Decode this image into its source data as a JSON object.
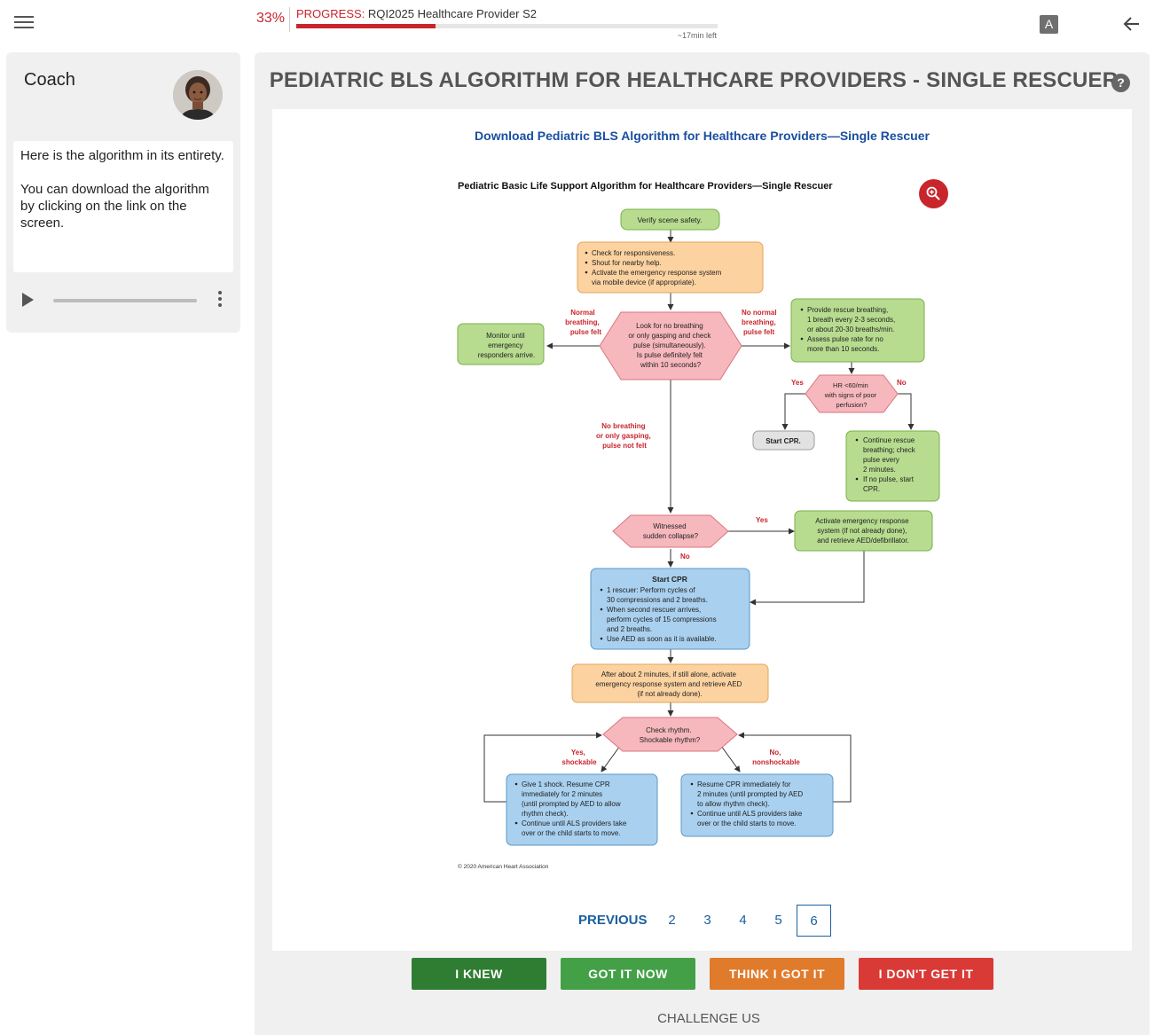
{
  "header": {
    "progress_percent_label": "33%",
    "progress_prefix": "PROGRESS:",
    "progress_course": "RQI2025 Healthcare Provider S2",
    "progress_value": 0.33,
    "time_left": "~17min left",
    "font_button_label": "A"
  },
  "coach": {
    "title": "Coach",
    "message_1": "Here is the algorithm in its entirety.",
    "message_2": "You can download the algorithm by clicking on the link on the screen."
  },
  "main": {
    "title": "PEDIATRIC BLS ALGORITHM FOR HEALTHCARE PROVIDERS - SINGLE RESCUER",
    "help_label": "?",
    "download_link": "Download Pediatric BLS Algorithm for Healthcare Providers—Single Rescuer"
  },
  "algorithm": {
    "title": "Pediatric Basic Life Support Algorithm for Healthcare Providers—Single Rescuer",
    "verify": "Verify scene safety.",
    "check": [
      "Check for responsiveness.",
      "Shout for nearby help.",
      "Activate the emergency response system",
      "via mobile device (if appropriate)."
    ],
    "look": [
      "Look for no breathing",
      "or only gasping and check",
      "pulse (simultaneously).",
      "Is pulse definitely felt",
      "within 10 seconds?"
    ],
    "normal_label": [
      "Normal",
      "breathing,",
      "pulse felt"
    ],
    "monitor": [
      "Monitor until",
      "emergency",
      "responders arrive."
    ],
    "no_normal_label": [
      "No normal",
      "breathing,",
      "pulse felt"
    ],
    "rescue": [
      "Provide rescue breathing,",
      "1 breath every 2-3 seconds,",
      "or about 20-30 breaths/min.",
      "Assess pulse rate for no",
      "more than 10 seconds."
    ],
    "hr_yes": "Yes",
    "hr_no": "No",
    "hr": [
      "HR <60/min",
      "with signs of poor",
      "perfusion?"
    ],
    "start_cpr_small": "Start CPR.",
    "continue": [
      "Continue rescue",
      "breathing; check",
      "pulse every",
      "2 minutes.",
      "If no pulse, start",
      "CPR."
    ],
    "no_breathing_label": [
      "No breathing",
      "or only gasping,",
      "pulse not felt"
    ],
    "witnessed": [
      "Witnessed",
      "sudden collapse?"
    ],
    "witnessed_yes": "Yes",
    "witnessed_no": "No",
    "activate": [
      "Activate emergency response",
      "system (if not already done),",
      "and retrieve AED/defibrillator."
    ],
    "cpr_title": "Start CPR",
    "cpr": [
      "1 rescuer: Perform cycles of",
      "30 compressions and 2 breaths.",
      "When second rescuer arrives,",
      "perform cycles of 15 compressions",
      "and 2 breaths.",
      "Use AED as soon as it is available."
    ],
    "after": [
      "After about 2 minutes, if still alone, activate",
      "emergency response system and retrieve AED",
      "(if not already done)."
    ],
    "rhythm": [
      "Check rhythm.",
      "Shockable rhythm?"
    ],
    "shockable_label": [
      "Yes,",
      "shockable"
    ],
    "nonshockable_label": [
      "No,",
      "nonshockable"
    ],
    "shock": [
      "Give 1 shock. Resume CPR",
      "immediately for 2 minutes",
      "(until prompted by AED to allow",
      "rhythm check).",
      "Continue until ALS providers take",
      "over or the child starts to move."
    ],
    "resume": [
      "Resume CPR immediately for",
      "2 minutes (until prompted by AED",
      "to allow rhythm check).",
      "Continue until ALS providers take",
      "over or the child starts to move."
    ],
    "copyright": "© 2020 American Heart Association"
  },
  "pagination": {
    "previous": "PREVIOUS",
    "pages": [
      "2",
      "3",
      "4",
      "5",
      "6"
    ],
    "current": "6"
  },
  "answers": {
    "knew": "I KNEW",
    "got_it_now": "GOT IT NOW",
    "think": "THINK I GOT IT",
    "dont": "I DON'T GET IT"
  },
  "challenge": "CHALLENGE US",
  "colors": {
    "brand_red": "#c8252c",
    "link_blue": "#1a4fa0",
    "knew": "#2e7d32",
    "got_it_now": "#43a047",
    "think": "#e07b2c",
    "dont": "#d93a36"
  },
  "icons": [
    "menu-icon",
    "font-size-icon",
    "back-arrow-icon",
    "help-icon",
    "zoom-in-icon",
    "play-icon",
    "more-vert-icon"
  ]
}
